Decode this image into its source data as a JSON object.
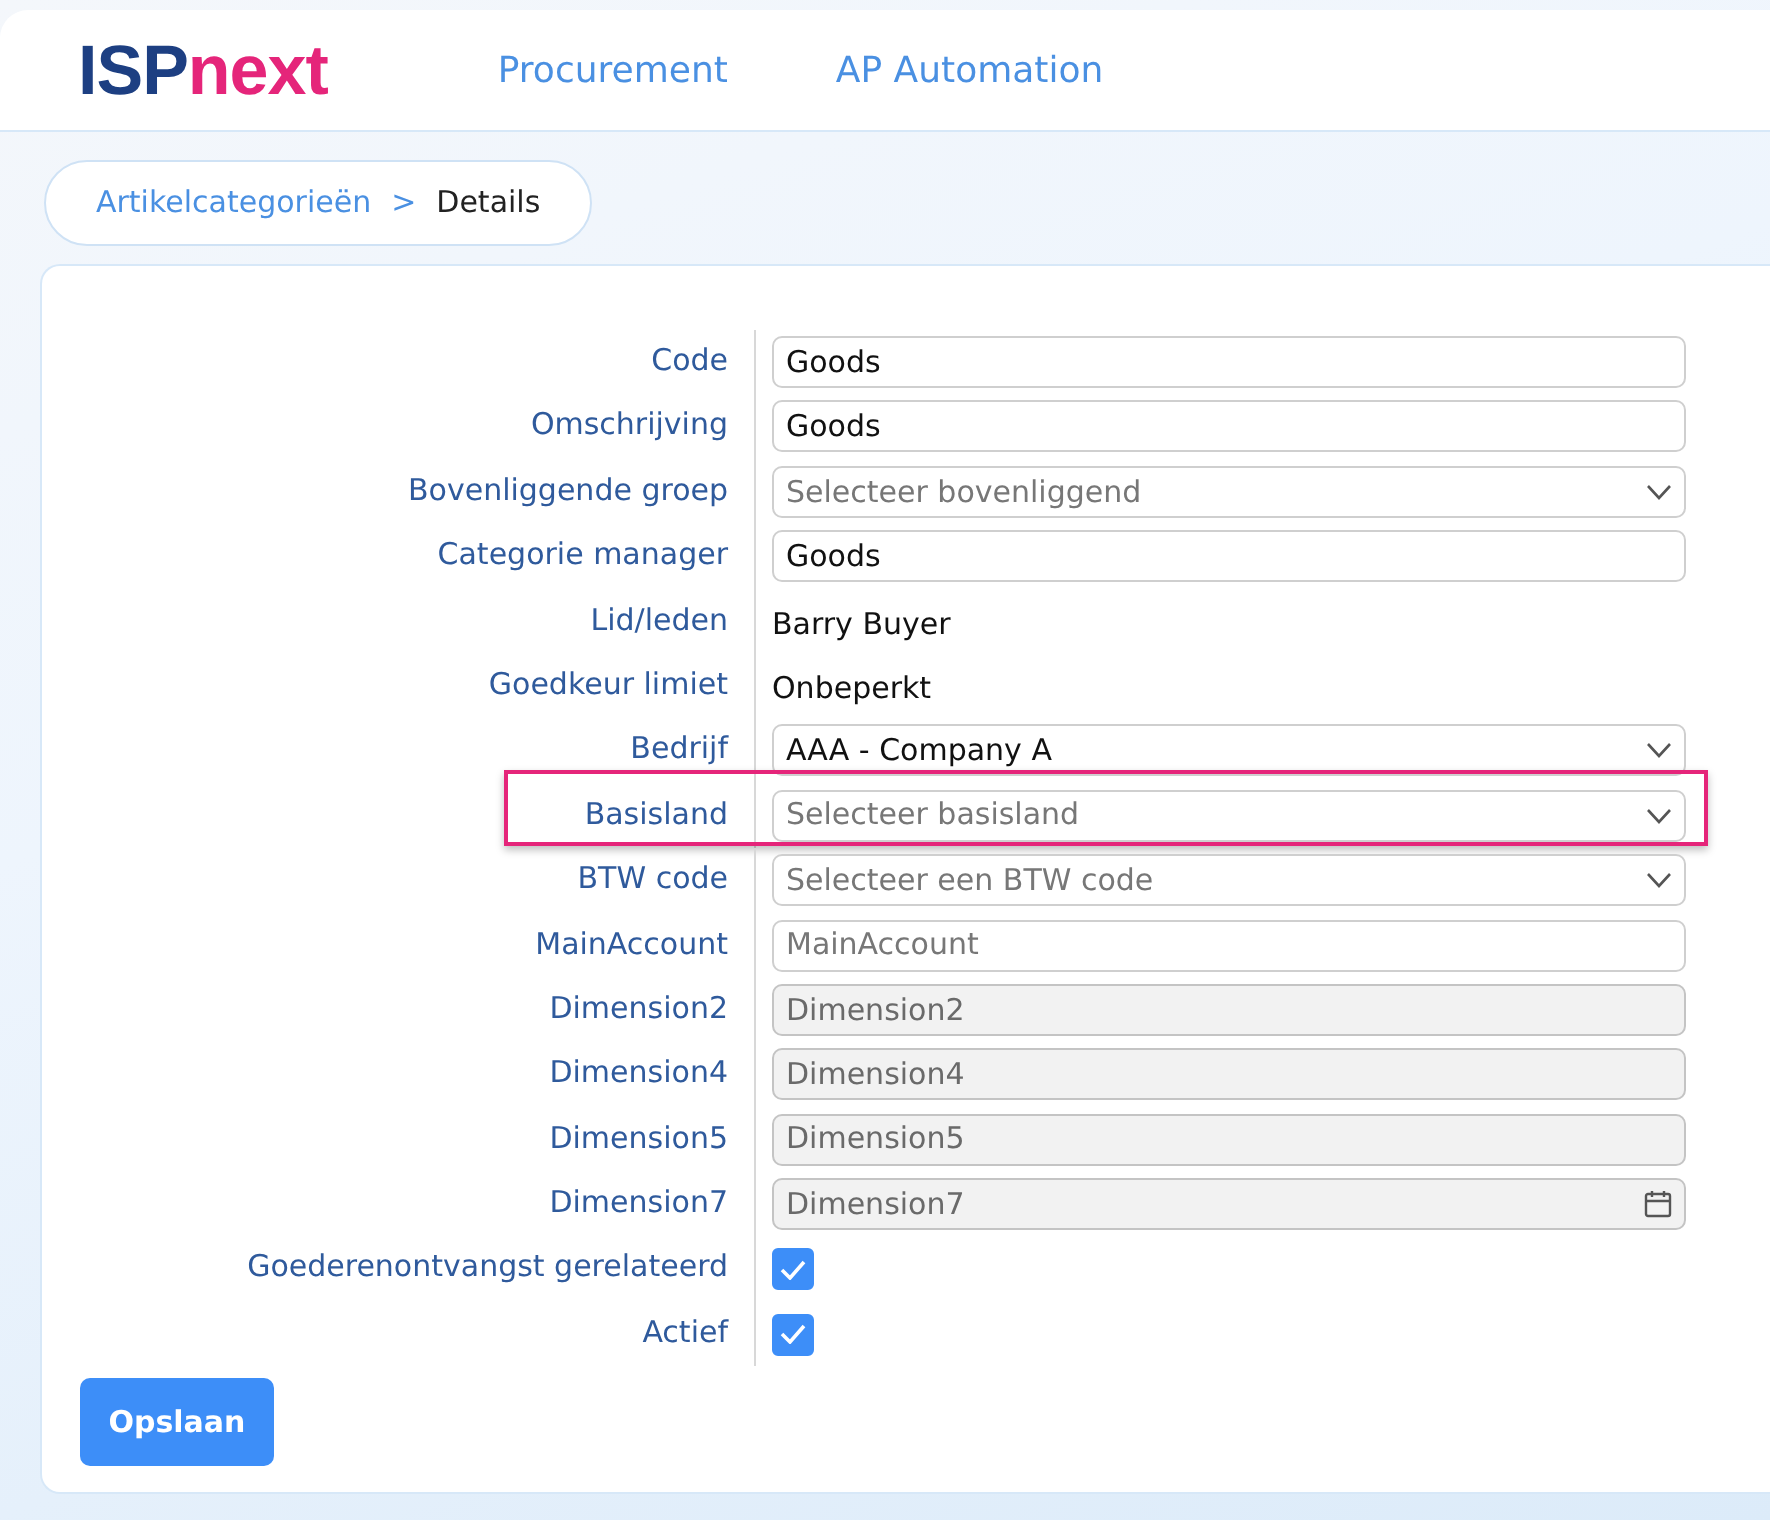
{
  "header": {
    "logo": {
      "part_1": "ISP",
      "part_2": "next"
    },
    "nav": [
      {
        "label": "Procurement"
      },
      {
        "label": "AP Automation"
      }
    ]
  },
  "breadcrumb": [
    {
      "label": "Artikelcategorieën",
      "kind": "link"
    },
    {
      "label": ">",
      "kind": "separator"
    },
    {
      "label": "Details",
      "kind": "current"
    }
  ],
  "form": {
    "fields": [
      {
        "label": "Code",
        "kind": "input",
        "value": "Goods"
      },
      {
        "label": "Omschrijving",
        "kind": "input",
        "value": "Goods"
      },
      {
        "label": "Bovenliggende groep",
        "kind": "select",
        "placeholder": "Selecteer bovenliggend"
      },
      {
        "label": "Categorie manager",
        "kind": "input",
        "value": "Goods"
      },
      {
        "label": "Lid/leden",
        "kind": "text",
        "value": "Barry Buyer"
      },
      {
        "label": "Goedkeur limiet",
        "kind": "text",
        "value": "Onbeperkt"
      },
      {
        "label": "Bedrijf",
        "kind": "select",
        "value": "AAA - Company A"
      },
      {
        "label": "Basisland",
        "kind": "select",
        "placeholder": "Selecteer basisland",
        "highlighted": true
      },
      {
        "label": "BTW code",
        "kind": "select",
        "placeholder": "Selecteer een BTW code"
      },
      {
        "label": "MainAccount",
        "kind": "input",
        "placeholder": "MainAccount",
        "disabled": false
      },
      {
        "label": "Dimension2",
        "kind": "input",
        "placeholder": "Dimension2",
        "disabled": true
      },
      {
        "label": "Dimension4",
        "kind": "input",
        "placeholder": "Dimension4",
        "disabled": true
      },
      {
        "label": "Dimension5",
        "kind": "input",
        "placeholder": "Dimension5",
        "disabled": true
      },
      {
        "label": "Dimension7",
        "kind": "date",
        "placeholder": "Dimension7",
        "disabled": true
      },
      {
        "label": "Goederenontvangst gerelateerd",
        "kind": "checkbox",
        "checked": true
      },
      {
        "label": "Actief",
        "kind": "checkbox",
        "checked": true
      }
    ],
    "save_button": "Opslaan"
  }
}
